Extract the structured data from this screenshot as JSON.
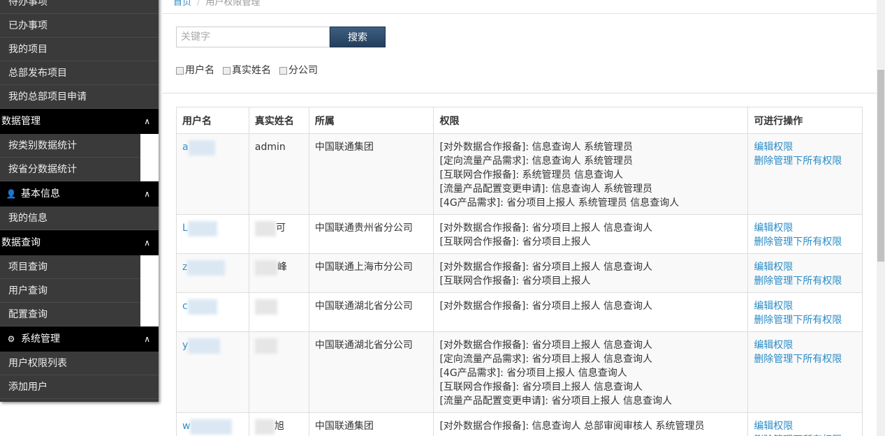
{
  "sidebar": {
    "top_items": [
      "待办事项",
      "已办事项",
      "我的项目",
      "总部发布项目",
      "我的总部项目申请"
    ],
    "sections": [
      {
        "title": "数据管理",
        "icon": "",
        "items": [
          "按类别数据统计",
          "按省分数据统计"
        ]
      },
      {
        "title": "基本信息",
        "icon": "user-icon",
        "items": [
          "我的信息"
        ]
      },
      {
        "title": "数据查询",
        "icon": "",
        "items": [
          "项目查询",
          "用户查询",
          "配置查询"
        ]
      },
      {
        "title": "系统管理",
        "icon": "gear-icon",
        "items": [
          "用户权限列表",
          "添加用户"
        ]
      }
    ]
  },
  "breadcrumb": {
    "home": "首页",
    "separator": "/",
    "current": "用户权限管理"
  },
  "search": {
    "placeholder": "关键字",
    "value": "",
    "button": "搜索"
  },
  "filters": [
    "用户名",
    "真实姓名",
    "分公司"
  ],
  "table": {
    "headers": [
      "用户名",
      "真实姓名",
      "所属",
      "权限",
      "可进行操作"
    ],
    "operations": {
      "edit": "编辑权限",
      "delete_all": "删除管理下所有权限"
    },
    "rows": [
      {
        "user": "a",
        "real_name": "admin",
        "org": "中国联通集团",
        "permissions": [
          "[对外数据合作报备]: 信息查询人 系统管理员",
          "[定向流量产品需求]: 信息查询人 系统管理员",
          "[互联网合作报备]: 系统管理员 信息查询人",
          "[流量产品配置变更申请]: 信息查询人 系统管理员",
          "[4G产品需求]: 省分项目上报人 系统管理员 信息查询人"
        ]
      },
      {
        "user": "L",
        "real_name": "可",
        "org": "中国联通贵州省分公司",
        "permissions": [
          "[对外数据合作报备]: 省分项目上报人 信息查询人",
          "[互联网合作报备]: 省分项目上报人"
        ]
      },
      {
        "user": "z",
        "real_name": "峰",
        "org": "中国联通上海市分公司",
        "permissions": [
          "[对外数据合作报备]: 省分项目上报人 信息查询人",
          "[互联网合作报备]: 省分项目上报人"
        ]
      },
      {
        "user": "c",
        "real_name": "",
        "org": "中国联通湖北省分公司",
        "permissions": [
          "[对外数据合作报备]: 省分项目上报人 信息查询人"
        ]
      },
      {
        "user": "y",
        "real_name": "",
        "org": "中国联通湖北省分公司",
        "permissions": [
          "[对外数据合作报备]: 省分项目上报人 信息查询人",
          "[定向流量产品需求]: 省分项目上报人 信息查询人",
          "[4G产品需求]: 省分项目上报人 信息查询人",
          "[互联网合作报备]: 省分项目上报人 信息查询人",
          "[流量产品配置变更申请]: 省分项目上报人 信息查询人"
        ]
      },
      {
        "user": "w",
        "real_name": "旭",
        "org": "中国联通集团",
        "permissions": [
          "[对外数据合作报备]: 信息查询人 总部审阅审核人 系统管理员"
        ]
      }
    ]
  },
  "colors": {
    "sidebar_bg": "#3a3a3a",
    "sidebar_header_bg": "#000000",
    "link": "#2a8cc7",
    "button": "#2f4d6d"
  }
}
